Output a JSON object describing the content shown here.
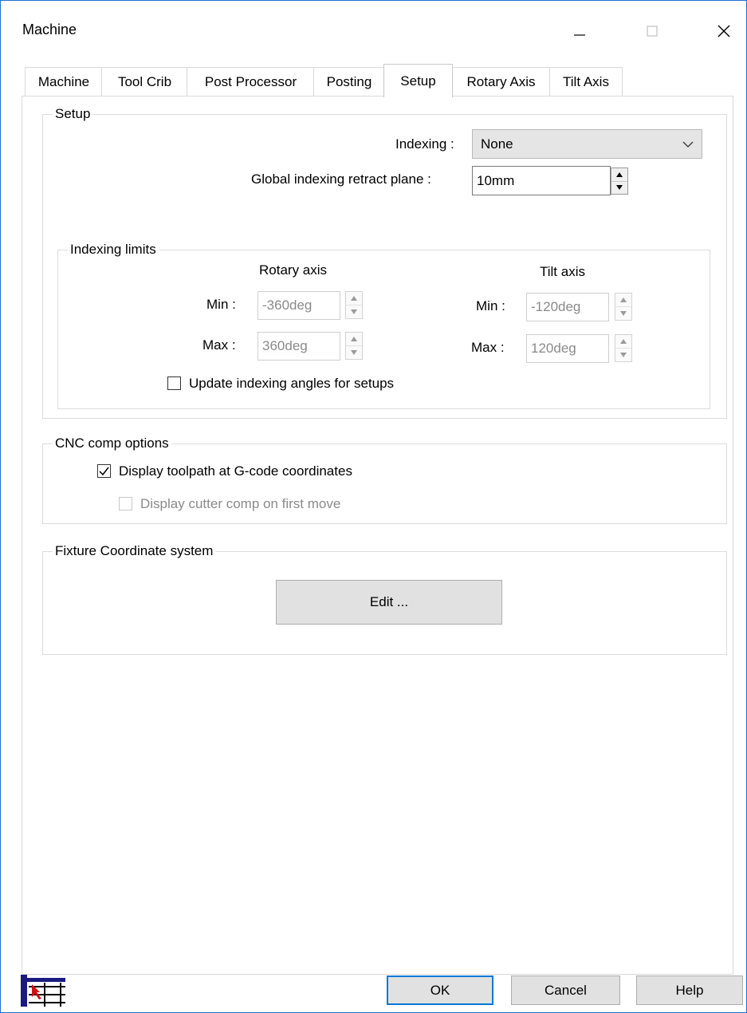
{
  "window": {
    "title": "Machine"
  },
  "tabs": [
    {
      "label": "Machine"
    },
    {
      "label": "Tool Crib"
    },
    {
      "label": "Post Processor"
    },
    {
      "label": "Posting"
    },
    {
      "label": "Setup"
    },
    {
      "label": "Rotary Axis"
    },
    {
      "label": "Tilt Axis"
    }
  ],
  "active_tab": "Setup",
  "setup": {
    "legend": "Setup",
    "indexing_label": "Indexing :",
    "indexing_value": "None",
    "retract_label": "Global indexing retract plane :",
    "retract_value": "10mm",
    "limits": {
      "legend": "Indexing limits",
      "rotary_header": "Rotary axis",
      "tilt_header": "Tilt axis",
      "min_label": "Min :",
      "max_label": "Max :",
      "rotary_min": "-360deg",
      "rotary_max": "360deg",
      "tilt_min": "-120deg",
      "tilt_max": "120deg",
      "update_label": "Update indexing angles for setups",
      "update_checked": false
    }
  },
  "cnc": {
    "legend": "CNC comp options",
    "display_toolpath_label": "Display toolpath at G-code coordinates",
    "display_toolpath_checked": true,
    "display_cutter_label": "Display cutter comp on first move",
    "display_cutter_checked": false
  },
  "fixture": {
    "legend": "Fixture Coordinate system",
    "edit_label": "Edit ..."
  },
  "footer": {
    "ok_label": "OK",
    "cancel_label": "Cancel",
    "help_label": "Help"
  },
  "colors": {
    "window_border": "#1f6fd0",
    "default_button_border": "#0078d7",
    "disabled_text": "#8a8a8a"
  }
}
